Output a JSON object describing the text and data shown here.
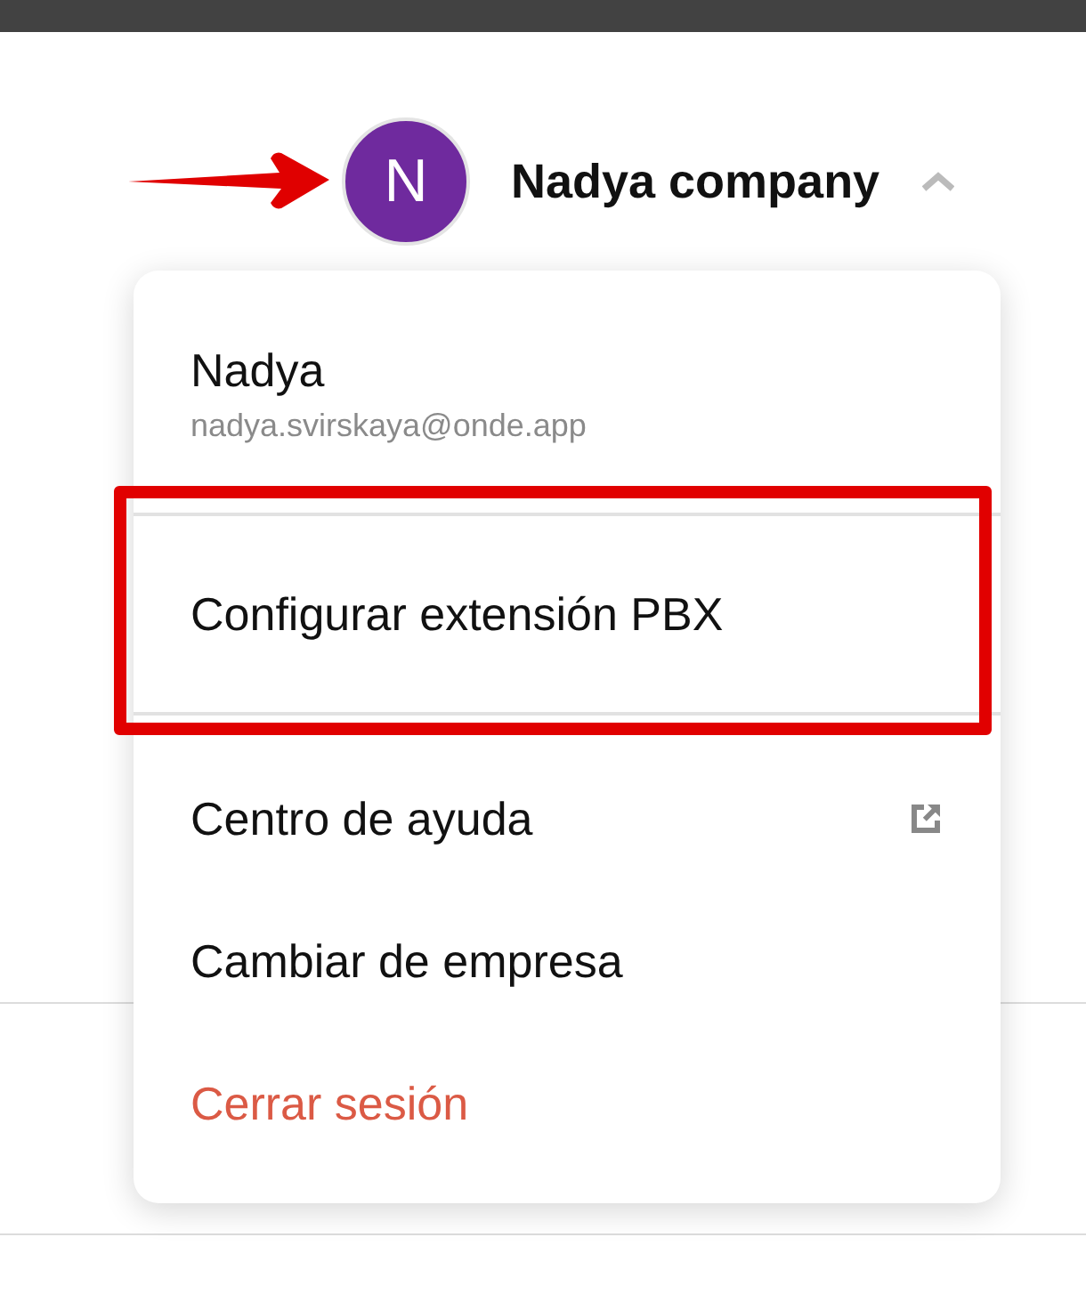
{
  "header": {
    "avatar_initial": "N",
    "company": "Nadya company",
    "menu_expanded": true
  },
  "menu": {
    "user_name": "Nadya",
    "email": "nadya.svirskaya@onde.app",
    "items": [
      {
        "label": "Configurar extensión PBX",
        "kind": "plain",
        "highlighted": true
      },
      {
        "label": "Centro de ayuda",
        "kind": "external",
        "highlighted": false
      },
      {
        "label": "Cambiar de empresa",
        "kind": "plain",
        "highlighted": false
      },
      {
        "label": "Cerrar sesión",
        "kind": "danger",
        "highlighted": false
      }
    ]
  }
}
